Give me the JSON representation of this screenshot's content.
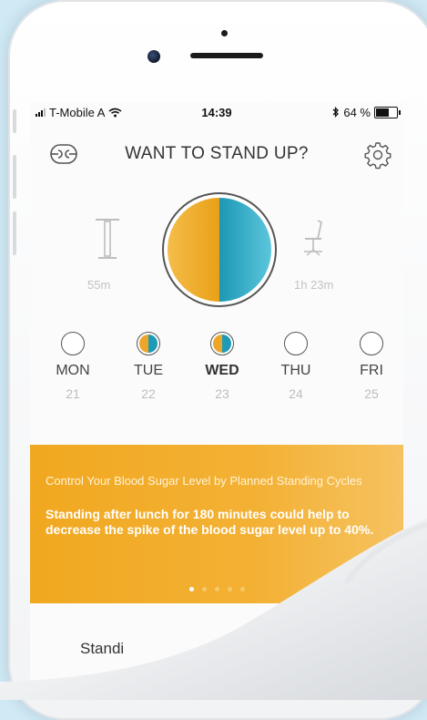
{
  "status_bar": {
    "carrier": "T-Mobile A",
    "time": "14:39",
    "battery": "64 %"
  },
  "header": {
    "title": "WANT TO STAND UP?"
  },
  "summary": {
    "standing_time": "55m",
    "sitting_time": "1h 23m"
  },
  "days": [
    {
      "name": "MON",
      "date": "21"
    },
    {
      "name": "TUE",
      "date": "22"
    },
    {
      "name": "WED",
      "date": "23"
    },
    {
      "name": "THU",
      "date": "24"
    },
    {
      "name": "FRI",
      "date": "25"
    }
  ],
  "tip": {
    "subtitle": "Control Your Blood Sugar Level by Planned Standing Cycles",
    "body": "Standing after lunch for 180 minutes could help to decrease the spike of the blood sugar level up to 40%."
  },
  "bottom": {
    "label": "Standi"
  },
  "colors": {
    "accent_orange": "#f1a820",
    "accent_teal": "#1d9ab7"
  }
}
